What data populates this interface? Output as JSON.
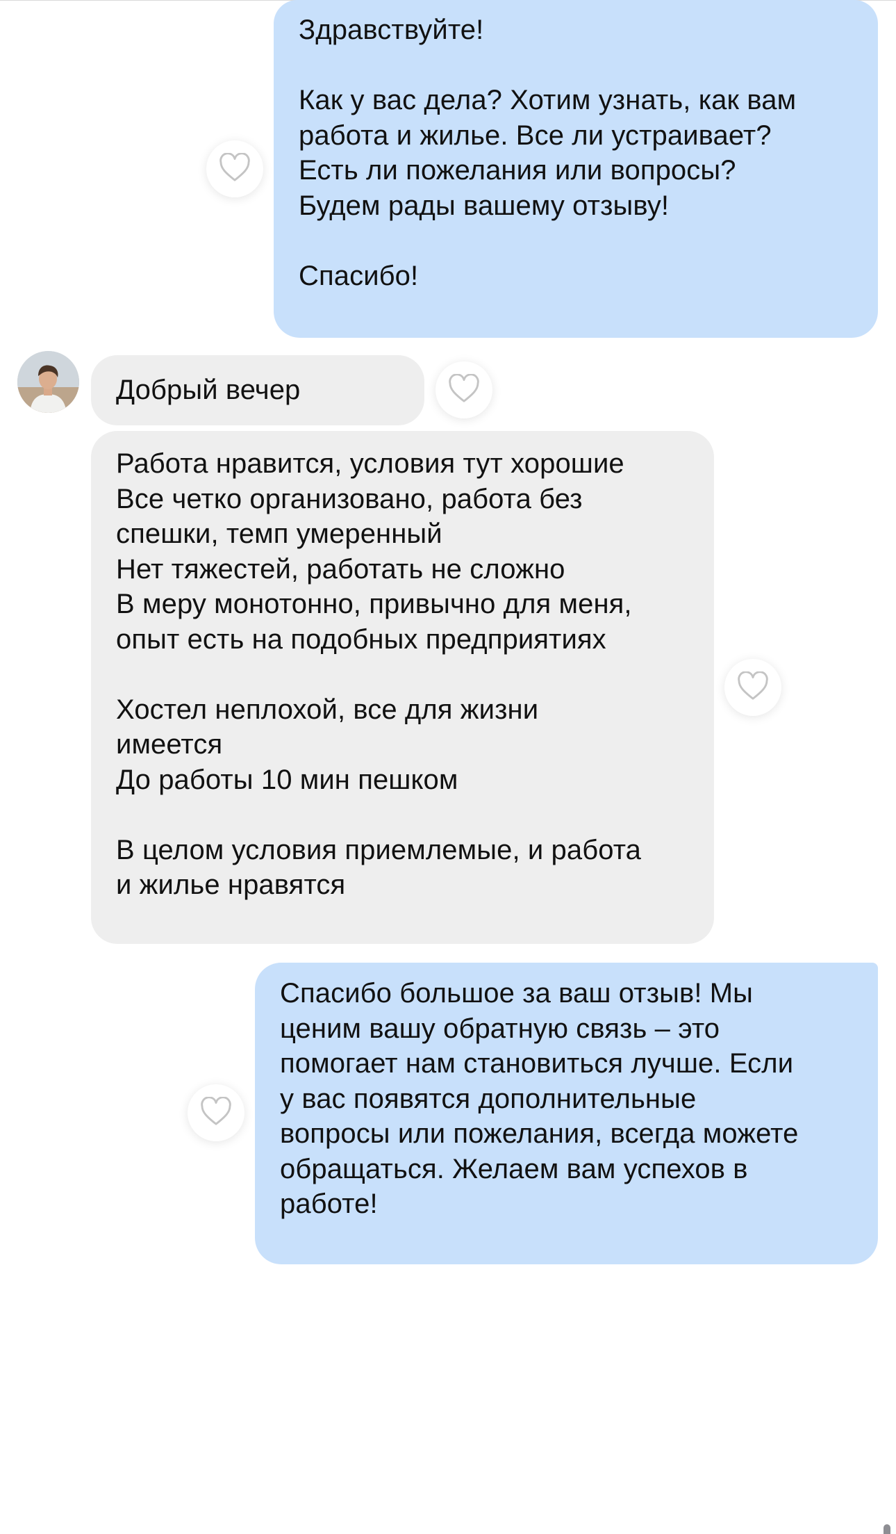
{
  "messages": [
    {
      "direction": "outgoing",
      "text": "Здравствуйте!\n\nКак у вас дела? Хотим узнать, как вам\nработа и жилье. Все ли устраивает?\nЕсть ли пожелания или вопросы?\nБудем рады вашему отзыву!\n\nСпасибо!",
      "reaction_icon": "heart-outline-icon"
    },
    {
      "direction": "incoming",
      "text": "Добрый вечер",
      "reaction_icon": "heart-outline-icon"
    },
    {
      "direction": "incoming",
      "text": "Работа нравится, условия тут хорошие\nВсе четко организовано, работа без\nспешки, темп умеренный\nНет тяжестей, работать не сложно\nВ меру монотонно, привычно для меня,\nопыт есть на подобных предприятиях\n\nХостел неплохой, все для жизни\nимеется\nДо работы 10 мин пешком\n\nВ целом условия приемлемые, и работа\nи жилье нравятся",
      "reaction_icon": "heart-outline-icon"
    },
    {
      "direction": "outgoing",
      "text": "Спасибо большое за ваш отзыв! Мы\nценим вашу обратную связь – это\nпомогает нам становиться лучше. Если\nу вас появятся дополнительные\nвопросы или пожелания, всегда можете\nобращаться. Желаем вам успехов в\nработе!",
      "reaction_icon": "heart-outline-icon"
    }
  ],
  "colors": {
    "outgoing_bubble": "#c8e0fb",
    "incoming_bubble": "#eeeeee",
    "background": "#ffffff",
    "text": "#111111",
    "heart_stroke": "#c4c4c4"
  }
}
